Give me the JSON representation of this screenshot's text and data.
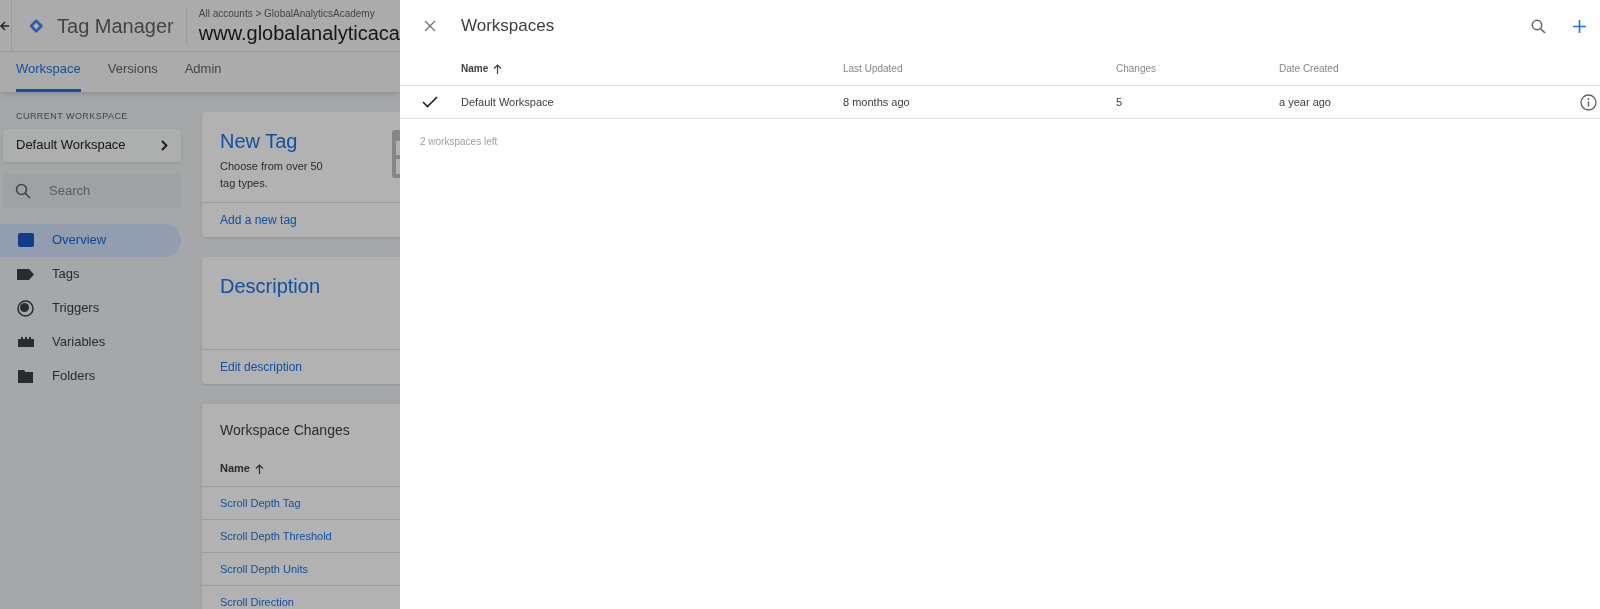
{
  "app": {
    "title": "Tag Manager",
    "breadcrumb": "All accounts > GlobalAnalyticsAcademy",
    "container": "www.globalanalyticaca"
  },
  "tabs": [
    {
      "label": "Workspace",
      "selected": true
    },
    {
      "label": "Versions",
      "selected": false
    },
    {
      "label": "Admin",
      "selected": false
    }
  ],
  "sidebar": {
    "section_label": "CURRENT WORKSPACE",
    "workspace": "Default Workspace",
    "search": {
      "placeholder": "Search"
    },
    "items": [
      {
        "label": "Overview",
        "kind": "overview",
        "selected": true
      },
      {
        "label": "Tags",
        "kind": "tags",
        "selected": false
      },
      {
        "label": "Triggers",
        "kind": "triggers",
        "selected": false
      },
      {
        "label": "Variables",
        "kind": "variables",
        "selected": false
      },
      {
        "label": "Folders",
        "kind": "folders",
        "selected": false
      }
    ]
  },
  "cards": {
    "new_tag": {
      "title": "New Tag",
      "text": "Choose from over 50 tag types.",
      "link": "Add a new tag"
    },
    "description": {
      "title": "Description",
      "link": "Edit description"
    },
    "changes": {
      "title": "Workspace Changes",
      "column": "Name",
      "rows": [
        "Scroll Depth Tag",
        "Scroll Depth Threshold",
        "Scroll Depth Units",
        "Scroll Direction"
      ]
    }
  },
  "panel": {
    "title": "Workspaces",
    "columns": [
      "Name",
      "Last Updated",
      "Changes",
      "Date Created"
    ],
    "rows": [
      {
        "name": "Default Workspace",
        "last_updated": "8 months ago",
        "changes": "5",
        "date_created": "a year ago",
        "selected": true
      }
    ],
    "footer": "2 workspaces left"
  }
}
